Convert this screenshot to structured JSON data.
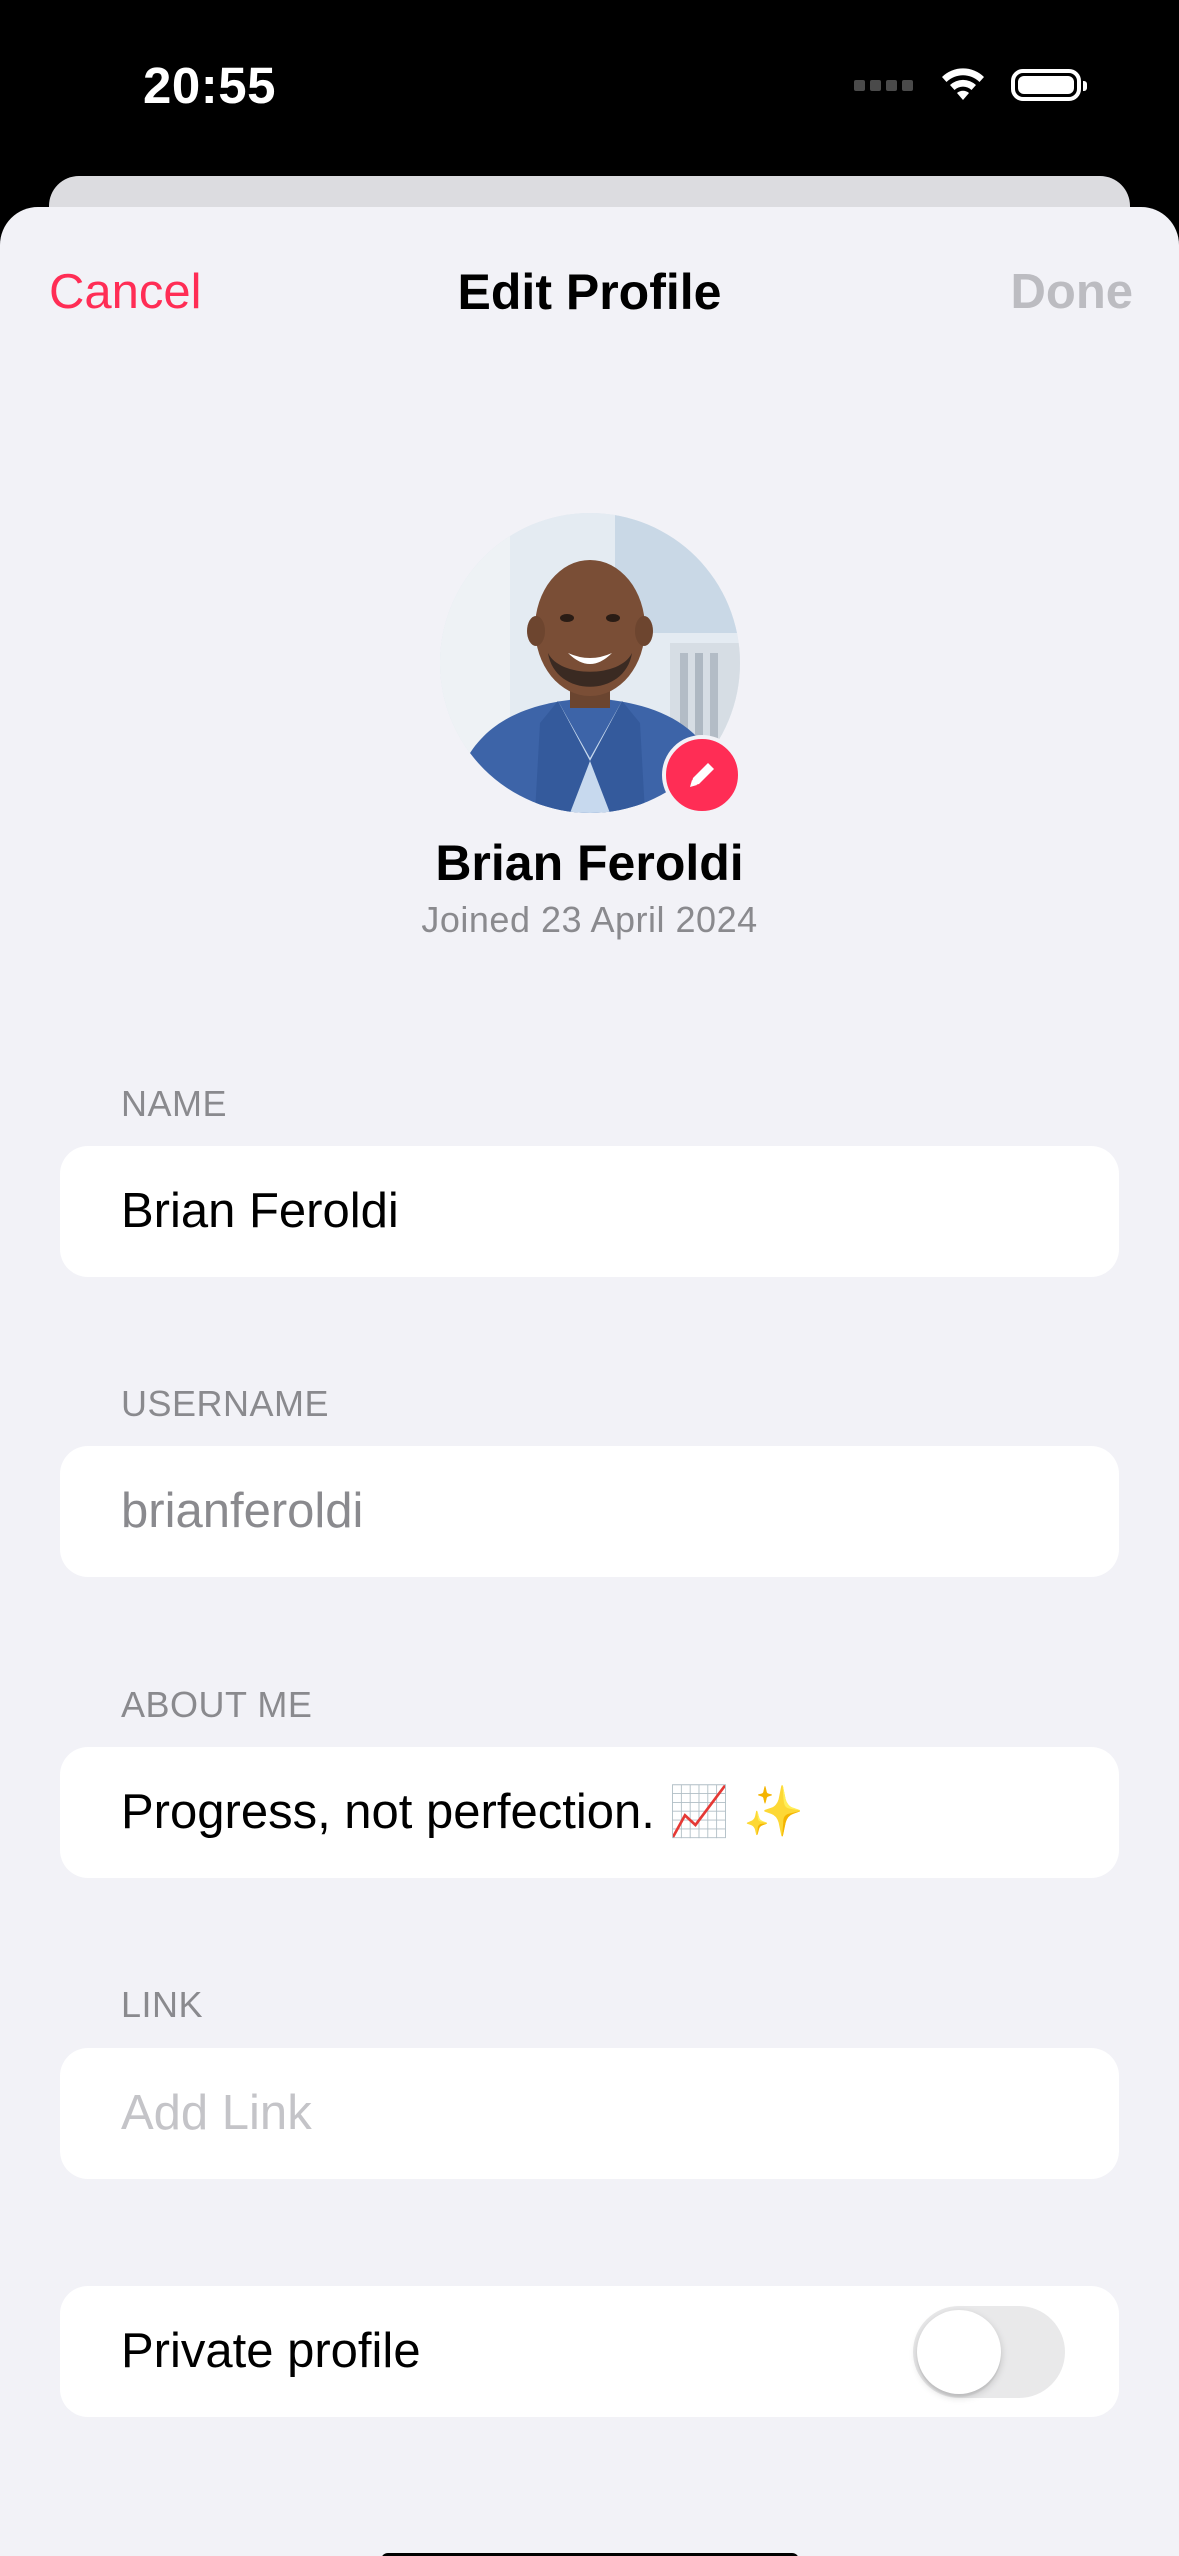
{
  "status_bar": {
    "time": "20:55",
    "icons": [
      "cellular-dots-icon",
      "wifi-icon",
      "battery-icon"
    ]
  },
  "nav": {
    "cancel_label": "Cancel",
    "title": "Edit Profile",
    "done_label": "Done"
  },
  "profile": {
    "name": "Brian Feroldi",
    "joined": "Joined 23 April 2024",
    "edit_icon": "pencil-icon"
  },
  "form": {
    "name_label": "NAME",
    "name_value": "Brian Feroldi",
    "username_label": "USERNAME",
    "username_value": "brianferoldi",
    "about_label": "ABOUT ME",
    "about_value": "Progress, not perfection. 📈 ✨",
    "link_label": "LINK",
    "link_placeholder": "Add Link",
    "private_label": "Private profile",
    "private_enabled": false
  },
  "colors": {
    "accent": "#ff2d55",
    "background": "#f2f2f7",
    "disabled": "#bcbcc1",
    "secondary_text": "#8a8a8e"
  }
}
